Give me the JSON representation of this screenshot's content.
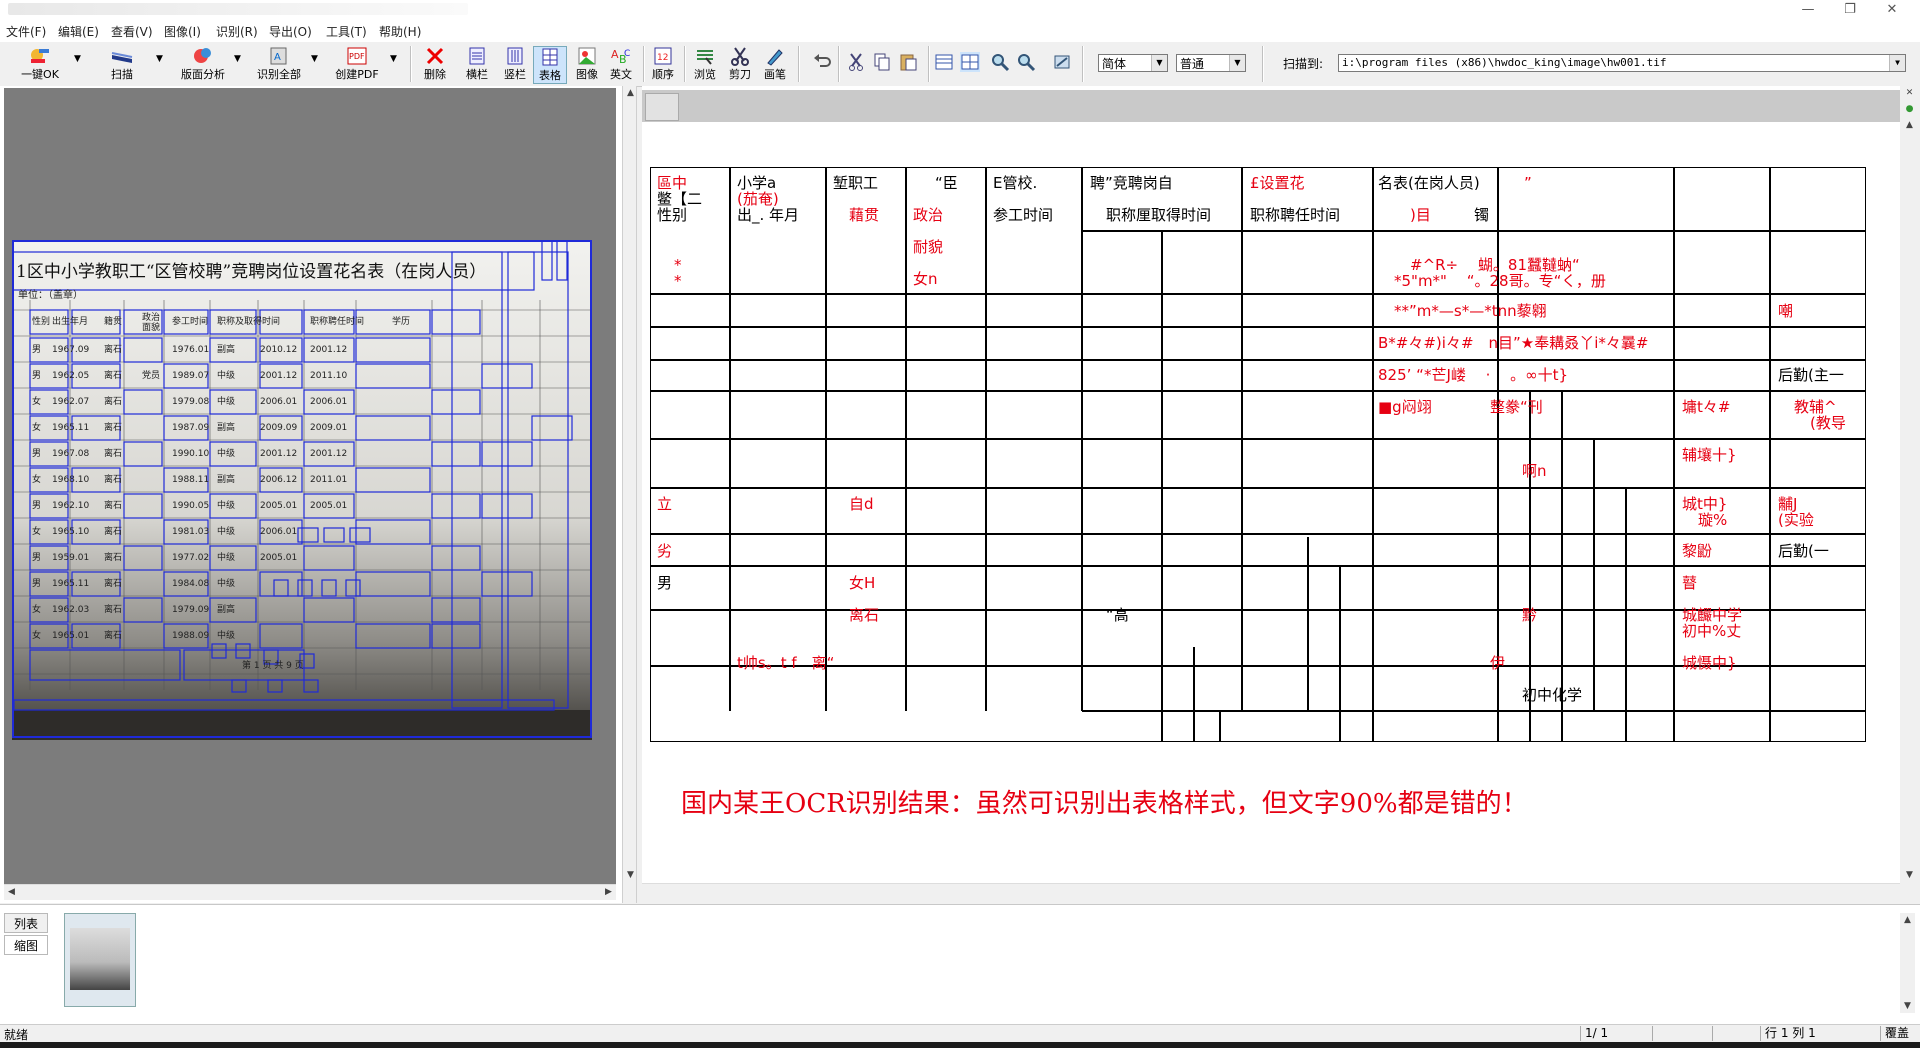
{
  "menu": [
    "文件(F)",
    "编辑(E)",
    "查看(V)",
    "图像(I)",
    "识别(R)",
    "导出(O)",
    "工具(T)",
    "帮助(H)"
  ],
  "toolbar": {
    "btn1": "一键OK",
    "btn2": "扫描",
    "btn3": "版面分析",
    "btn4": "识别全部",
    "btn5": "创建PDF",
    "btn6": "删除",
    "btn7": "横栏",
    "btn8": "竖栏",
    "btn9": "表格",
    "btn10": "图像",
    "btn11": "英文",
    "btn12": "顺序",
    "btn13": "浏览",
    "btn14": "剪刀",
    "btn15": "画笔",
    "font_select": "简体",
    "mode_select": "普通",
    "scan_label": "扫描到:",
    "scan_path": "i:\\program files (x86)\\hwdoc_king\\image\\hw001.tif"
  },
  "document": {
    "title": "区中小学教职工“区管校聘”竞聘岗位设置花名表（在岗人员）",
    "unit": "单位：（盖章）",
    "headers": [
      "性别",
      "出生年月",
      "籍贯",
      "政治面貌",
      "参工时间",
      "职称及取得时间",
      "职称聘任时间",
      "学历"
    ],
    "page_footer": "第 1 页 共 9 页"
  },
  "ocr": {
    "t1": "區中",
    "t1b": "鳖【二",
    "t1c": "性别",
    "t2": "小学a",
    "t2b": "(茄奄)",
    "t2c": "出_. 年月",
    "t3": "堑职工",
    "t3b": "藉贯",
    "t4": "“臣",
    "t4b": "政治",
    "t4c": "耐貌",
    "t4d": "女n",
    "t5": "E管校.",
    "t5b": "参工时间",
    "t6": "聘”竞聘岗自",
    "t6b": "职称厘取得时间",
    "t7": "£设置花",
    "t7b": "职称聘任时间",
    "t8": "名表(在岗人员)",
    "t8q": "”",
    "t8b": ")目",
    "t8c": "镯",
    "star1": "*",
    "star2": "*",
    "t9": "#^R÷　 蝴。81蠶韃蚋“",
    "t9b": "*5\"m*\"　 “。28哥。专“く，册",
    "t10": "**”m*—s*—*tnn藜翱",
    "t10b": "嘲",
    "t11": "B*#々#)i々#　n目”★奉耩叒丫i*々曩#",
    "t12": "825’ “*芒J嵝　 ·　 。∞十t}",
    "t12b": "后勤(主一",
    "t13": "■g闷翊",
    "t13b": "整豢“刊",
    "t13c": "墉t々#",
    "t13d": "教辅^",
    "t13e": "(教导",
    "t14": "啊n",
    "t14b": "辅壤十}",
    "t15": "立",
    "t15b": "自d",
    "t15c": "城t中}",
    "t15d": "璇%",
    "t15e": "黼J",
    "t15f": "(实验",
    "t16": "劣",
    "t16b": "黎鼢",
    "t16c": "后勤(一",
    "t17": "男",
    "t17b": "女H",
    "t17c": "瞽",
    "t18": "离石",
    "t18b": "“高",
    "t18c": "黔",
    "t18d": "城麣中学",
    "t18e": "初中%丈",
    "t19": "t帅s。t f　离“",
    "t19b": "伊",
    "t19c": "城慑中}",
    "t20": "初中化学"
  },
  "caption": "国内某王OCR识别结果：虽然可识别出表格样式，但文字90%都是错的！",
  "tabs": {
    "list": "列表",
    "thumb": "缩图"
  },
  "status": {
    "ready": "就绪",
    "page": "1/ 1",
    "rowcol": "行 1 列 1",
    "mode": "覆盖"
  }
}
